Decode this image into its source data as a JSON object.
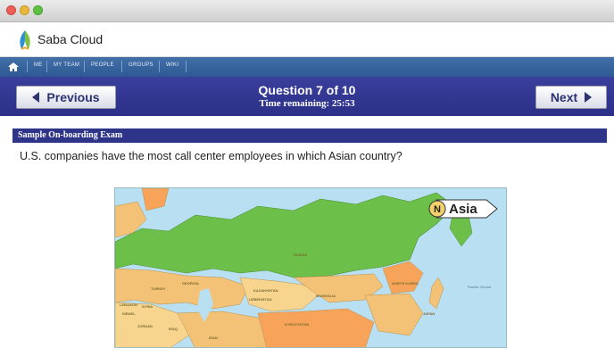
{
  "window": {
    "controls": [
      "close",
      "minimize",
      "maximize"
    ]
  },
  "app": {
    "name": "Saba Cloud",
    "logo_icon": "saba-leaf-icon"
  },
  "nav": {
    "home_icon": "home-icon",
    "items": [
      "ME",
      "MY TEAM",
      "PEOPLE",
      "GROUPS",
      "WIKI"
    ]
  },
  "quiz": {
    "previous_label": "Previous",
    "next_label": "Next",
    "title": "Question 7 of 10",
    "time_remaining": "Time remaining: 25:53",
    "exam_name": "Sample On-boarding Exam",
    "question_text": "U.S. companies have the most call center employees in which Asian country?"
  },
  "map": {
    "badge_letter": "N",
    "badge_text": "Asia",
    "labels": [
      "RUSSIA",
      "MONGOLIA",
      "KAZAKHSTAN",
      "UZBEKISTAN",
      "KYRGYZSTAN",
      "NORTH KOREA",
      "JAPAN",
      "Pacific Ocean",
      "TURKEY",
      "SYRIA",
      "LEBANON",
      "ISRAEL",
      "JORDAN",
      "IRAQ",
      "IRAN",
      "GEORGIA"
    ]
  },
  "colors": {
    "question_bar": "#2b2f86",
    "nav_bar": "#2d5a93",
    "exam_bar": "#2e3488",
    "land_russia": "#6cc04a",
    "land_other": "#f3c277",
    "water": "#b9e0f2"
  }
}
